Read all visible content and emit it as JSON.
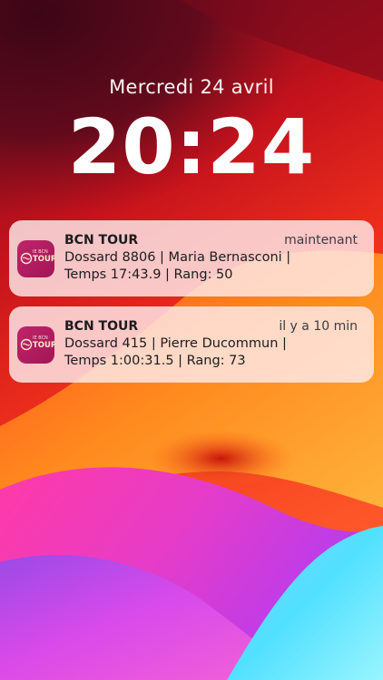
{
  "lockscreen": {
    "date": "Mercredi 24 avril",
    "time": "20:24"
  },
  "notifications": [
    {
      "app_name": "BCN TOUR",
      "time": "maintenant",
      "line1": "Dossard 8806 | Maria Bernasconi |",
      "line2": "Temps 17:43.9 | Rang: 50",
      "icon": "bcn-tour-app-icon"
    },
    {
      "app_name": "BCN TOUR",
      "time": "il y a 10 min",
      "line1": "Dossard 415 | Pierre Ducommun |",
      "line2": "Temps 1:00:31.5 | Rang: 73",
      "icon": "bcn-tour-app-icon"
    }
  ],
  "app_icon": {
    "small_text": "IE BCN",
    "big_text": "TOUR"
  },
  "colors": {
    "top_dark": "#4a0a1a",
    "red": "#e01c1c",
    "orange": "#ff7a1a",
    "pink": "#f43aa0",
    "purple": "#b23cf0",
    "cyan": "#4fd8ff",
    "icon_bg": "#b01c60"
  }
}
